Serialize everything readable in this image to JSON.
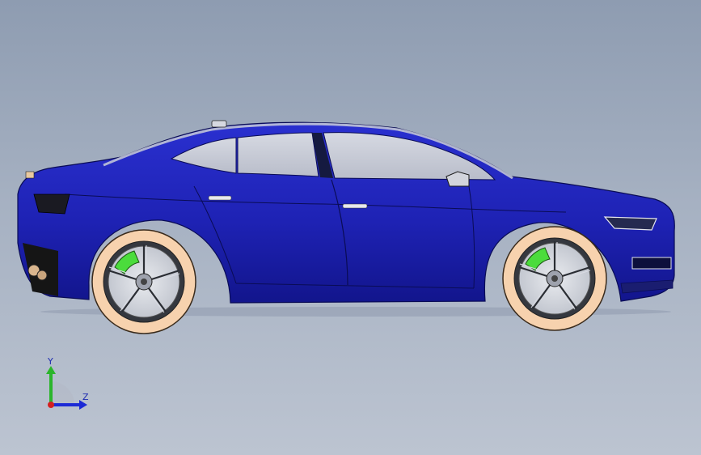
{
  "viewport": {
    "background_top": "#8e9cb1",
    "background_bottom": "#bcc4d1"
  },
  "model": {
    "body_color": "#1e22b4",
    "body_shadow": "#10138a",
    "glass_color": "#c7cbd6",
    "tire_color": "#f7d2ae",
    "caliper_color": "#4bdc3c",
    "rim_color": "#d9dbe3"
  },
  "triad": {
    "y_label": "Y",
    "z_label": "Z",
    "y_color": "#2bb52b",
    "z_color": "#1c2ad6",
    "x_color": "#d42020"
  }
}
